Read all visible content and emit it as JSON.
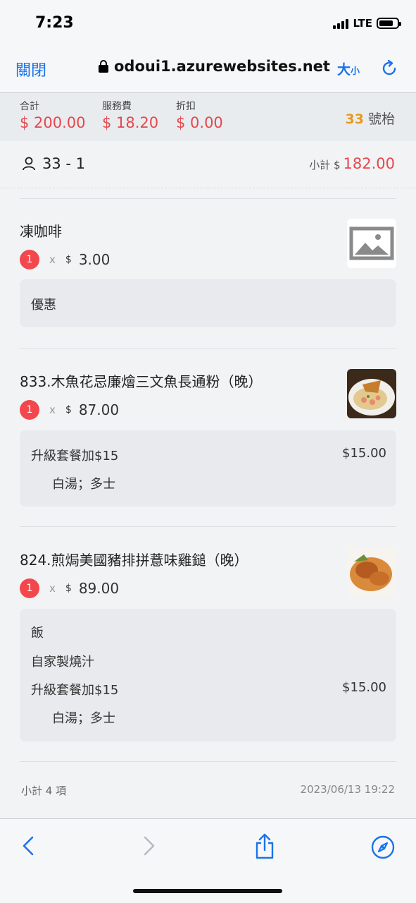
{
  "status": {
    "time": "7:23",
    "network": "LTE"
  },
  "browser": {
    "close_label": "關閉",
    "url": "odoui1.azurewebsites.net",
    "size_big": "大",
    "size_small": "小"
  },
  "summary": {
    "total_label": "合計",
    "total_value": "$ 200.00",
    "service_label": "服務費",
    "service_value": "$ 18.20",
    "discount_label": "折扣",
    "discount_value": "$ 0.00",
    "table_number": "33",
    "table_suffix": "號枱"
  },
  "order": {
    "guest": "33 - 1",
    "subtotal_label": "小計 $",
    "subtotal_value": "182.00"
  },
  "items": [
    {
      "name": "凍咖啡",
      "qty": "1",
      "x": "x",
      "currency": "$",
      "price": "3.00",
      "options": [
        {
          "label": "優惠",
          "price": ""
        }
      ]
    },
    {
      "name": "833.木魚花忌廉燴三文魚長通粉（晚）",
      "qty": "1",
      "x": "x",
      "currency": "$",
      "price": "87.00",
      "options": [
        {
          "label": "升級套餐加$15",
          "price": "$15.00"
        },
        {
          "label": "白湯；多士",
          "price": ""
        }
      ]
    },
    {
      "name": "824.煎焗美國豬排拼薏味雞鎚（晚）",
      "qty": "1",
      "x": "x",
      "currency": "$",
      "price": "89.00",
      "options": [
        {
          "label": "飯",
          "price": ""
        },
        {
          "label": "自家製燒汁",
          "price": ""
        },
        {
          "label": "升級套餐加$15",
          "price": "$15.00"
        },
        {
          "label": "白湯；多士",
          "price": ""
        }
      ]
    }
  ],
  "footer": {
    "count_text": "小計 4 項",
    "datetime": "2023/06/13 19:22"
  },
  "colors": {
    "accent_blue": "#1a73e8",
    "price_red": "#e5484d",
    "table_orange": "#e69a1c"
  }
}
